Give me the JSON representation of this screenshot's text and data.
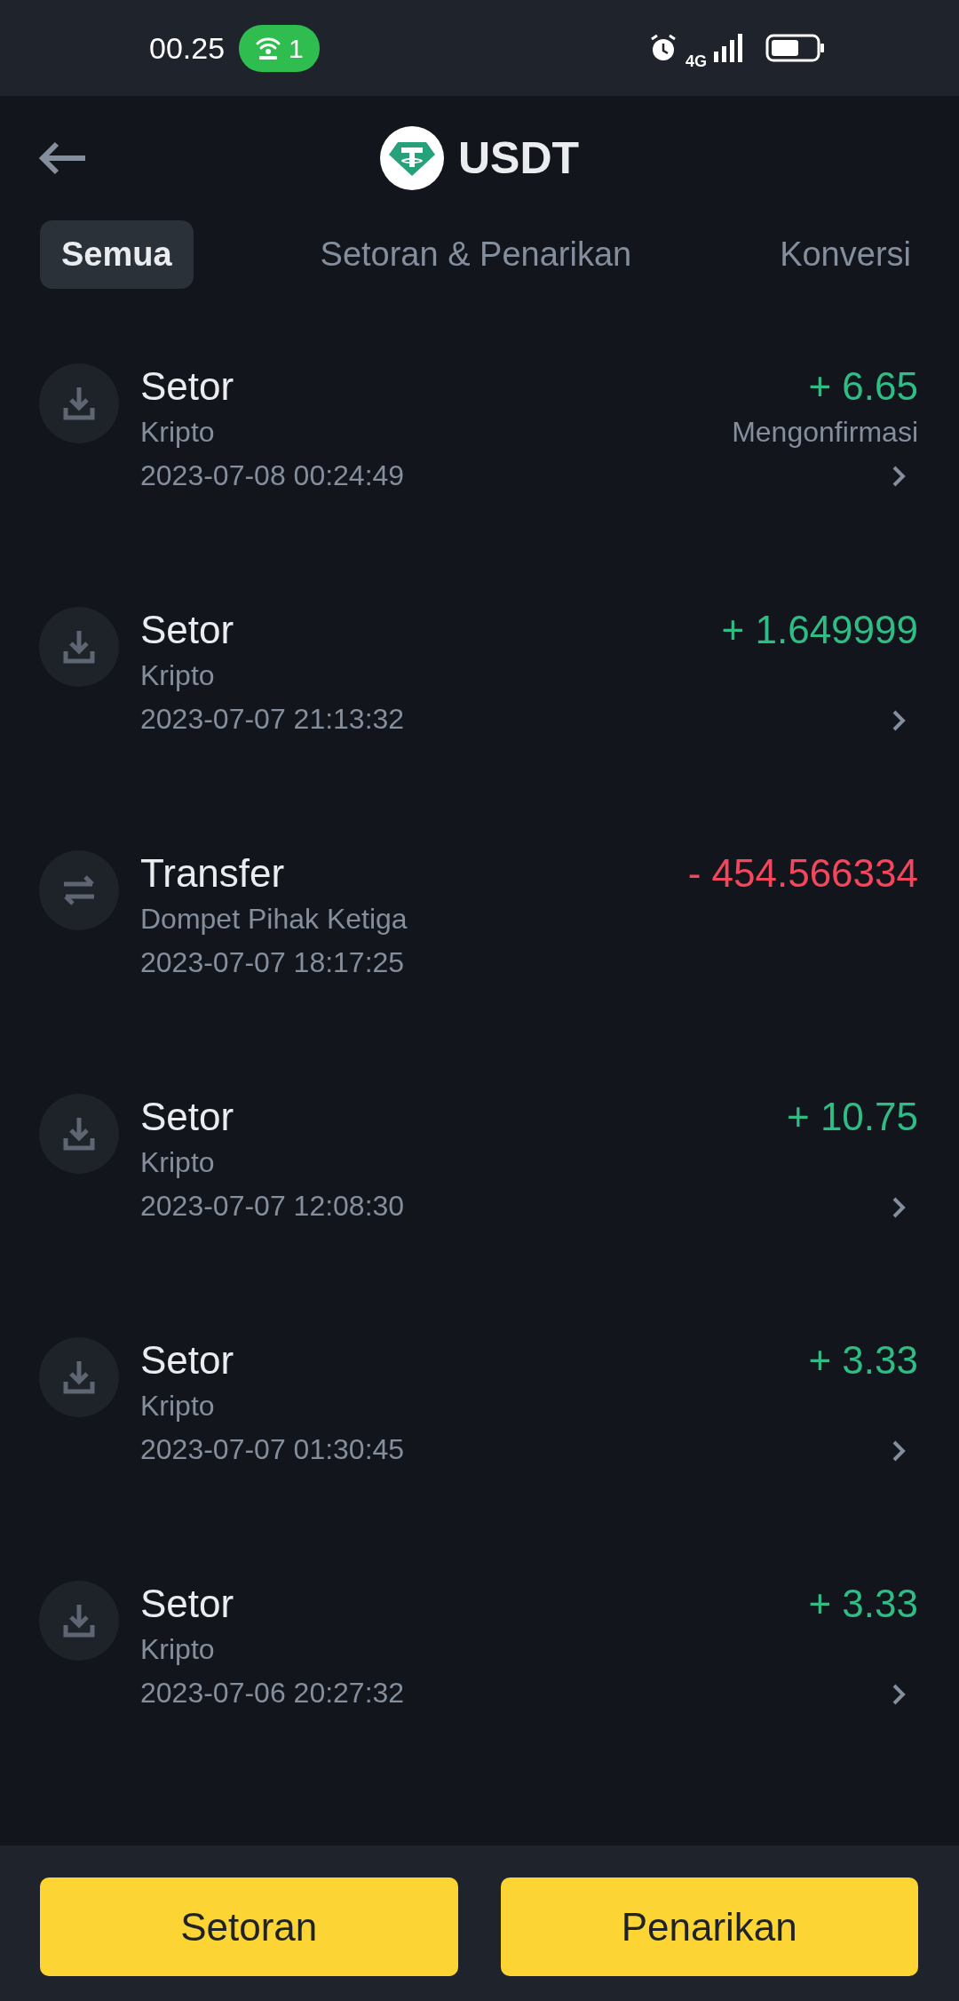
{
  "status_bar": {
    "time": "00.25",
    "hotspot_count": "1",
    "network": "4G"
  },
  "header": {
    "title": "USDT"
  },
  "tabs": [
    {
      "label": "Semua",
      "selected": true
    },
    {
      "label": "Setoran & Penarikan",
      "selected": false
    },
    {
      "label": "Konversi",
      "selected": false
    }
  ],
  "transactions": [
    {
      "kind": "deposit",
      "title": "Setor",
      "subtitle": "Kripto",
      "datetime": "2023-07-08 00:24:49",
      "amount": "+ 6.65",
      "color": "#2ebd85",
      "status": "Mengonfirmasi",
      "chevron": true
    },
    {
      "kind": "deposit",
      "title": "Setor",
      "subtitle": "Kripto",
      "datetime": "2023-07-07 21:13:32",
      "amount": "+ 1.649999",
      "color": "#2ebd85",
      "chevron": true
    },
    {
      "kind": "transfer",
      "title": "Transfer",
      "subtitle": "Dompet Pihak Ketiga",
      "datetime": "2023-07-07 18:17:25",
      "amount": "- 454.566334",
      "color": "#f6465d",
      "chevron": false
    },
    {
      "kind": "deposit",
      "title": "Setor",
      "subtitle": "Kripto",
      "datetime": "2023-07-07 12:08:30",
      "amount": "+ 10.75",
      "color": "#2ebd85",
      "chevron": true
    },
    {
      "kind": "deposit",
      "title": "Setor",
      "subtitle": "Kripto",
      "datetime": "2023-07-07 01:30:45",
      "amount": "+ 3.33",
      "color": "#2ebd85",
      "chevron": true
    },
    {
      "kind": "deposit",
      "title": "Setor",
      "subtitle": "Kripto",
      "datetime": "2023-07-06 20:27:32",
      "amount": "+ 3.33",
      "color": "#2ebd85",
      "chevron": true
    }
  ],
  "buttons": [
    {
      "label": "Setoran"
    },
    {
      "label": "Penarikan"
    }
  ]
}
